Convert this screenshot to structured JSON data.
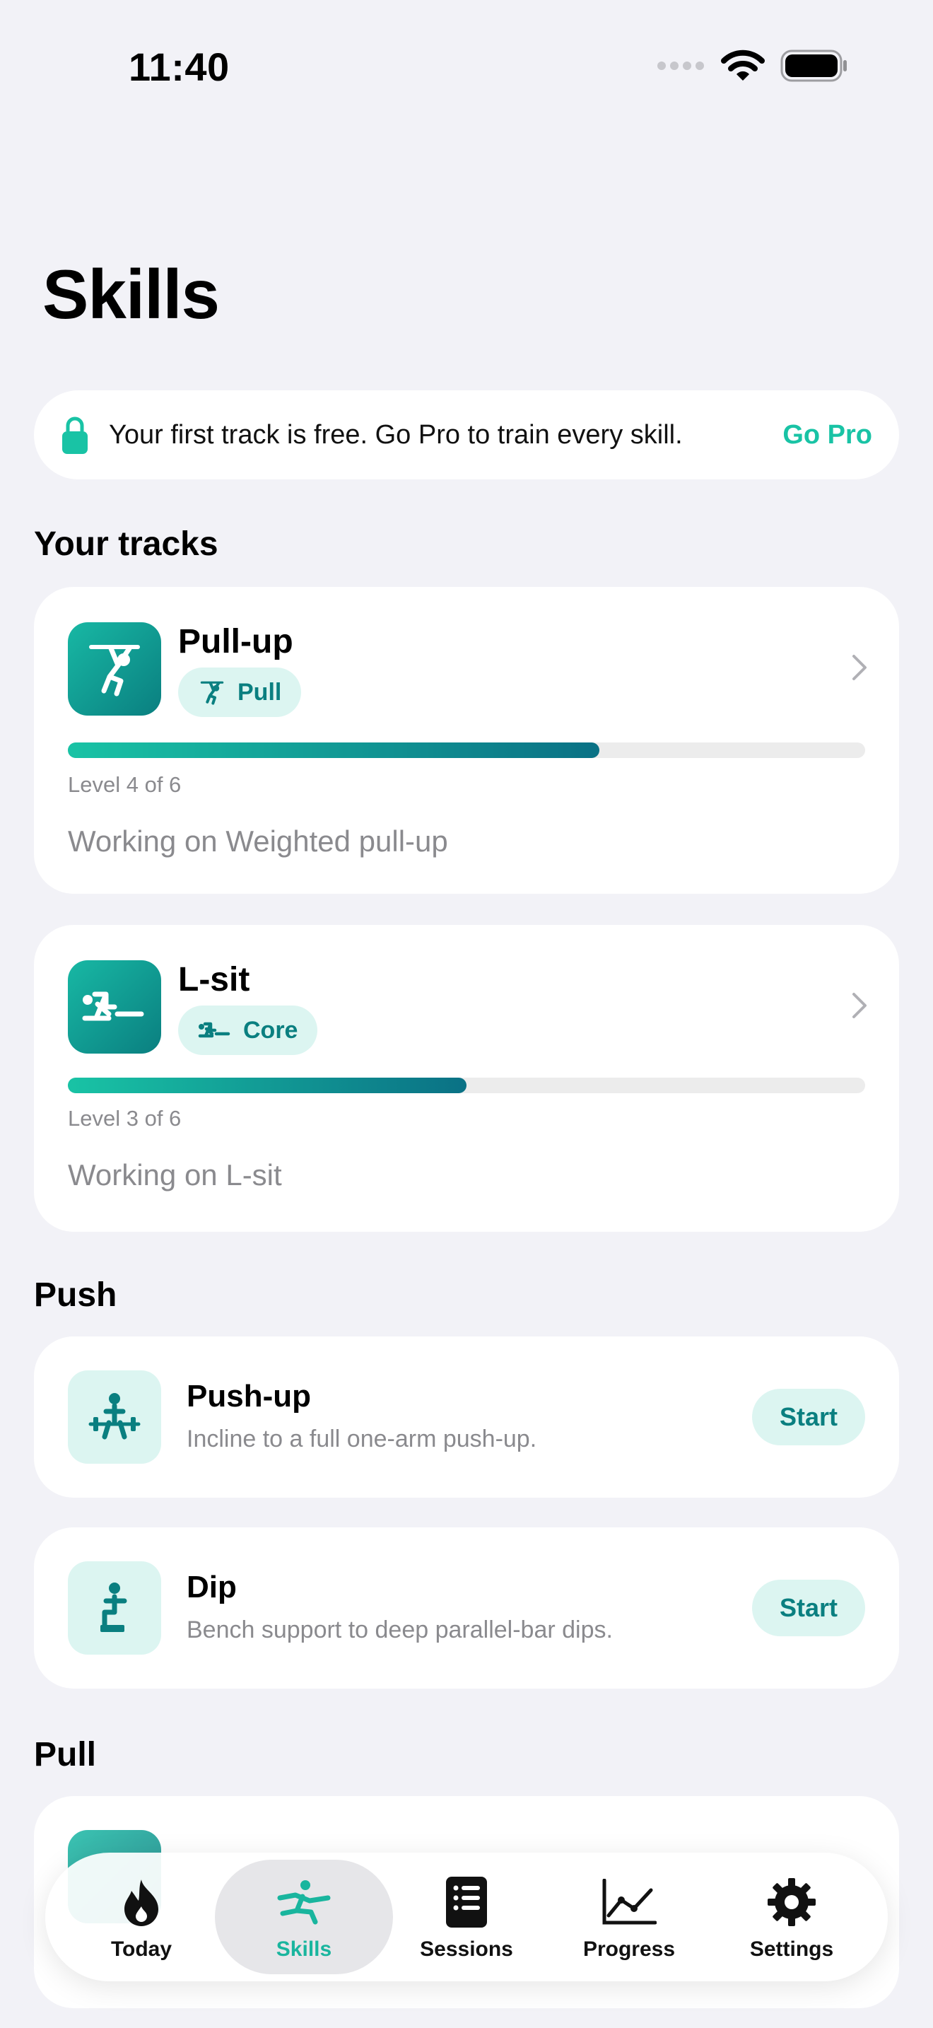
{
  "status_bar": {
    "time": "11:40"
  },
  "page": {
    "title": "Skills"
  },
  "promo": {
    "text": "Your first track is free. Go Pro to train every skill.",
    "link_label": "Go Pro"
  },
  "sections": {
    "your_tracks": "Your tracks",
    "push": "Push",
    "pull": "Pull"
  },
  "tracks": [
    {
      "title": "Pull-up",
      "category": "Pull",
      "level_text": "Level 4 of 6",
      "progress": 0.6667,
      "working_on": "Working on Weighted pull-up"
    },
    {
      "title": "L-sit",
      "category": "Core",
      "level_text": "Level 3 of 6",
      "progress": 0.5,
      "working_on": "Working on L-sit"
    }
  ],
  "push_skills": [
    {
      "title": "Push-up",
      "description": "Incline to a full one-arm push-up.",
      "button_label": "Start"
    },
    {
      "title": "Dip",
      "description": "Bench support to deep parallel-bar dips.",
      "button_label": "Start"
    }
  ],
  "tabs": [
    {
      "label": "Today",
      "icon": "flame-icon"
    },
    {
      "label": "Skills",
      "icon": "skills-figure-icon",
      "active": true
    },
    {
      "label": "Sessions",
      "icon": "list-icon"
    },
    {
      "label": "Progress",
      "icon": "chart-icon"
    },
    {
      "label": "Settings",
      "icon": "gear-icon"
    }
  ],
  "colors": {
    "accent": "#19c3a5",
    "accent_dark": "#0a7f80",
    "pill_bg": "#dcf5f1",
    "background": "#f2f2f7"
  }
}
